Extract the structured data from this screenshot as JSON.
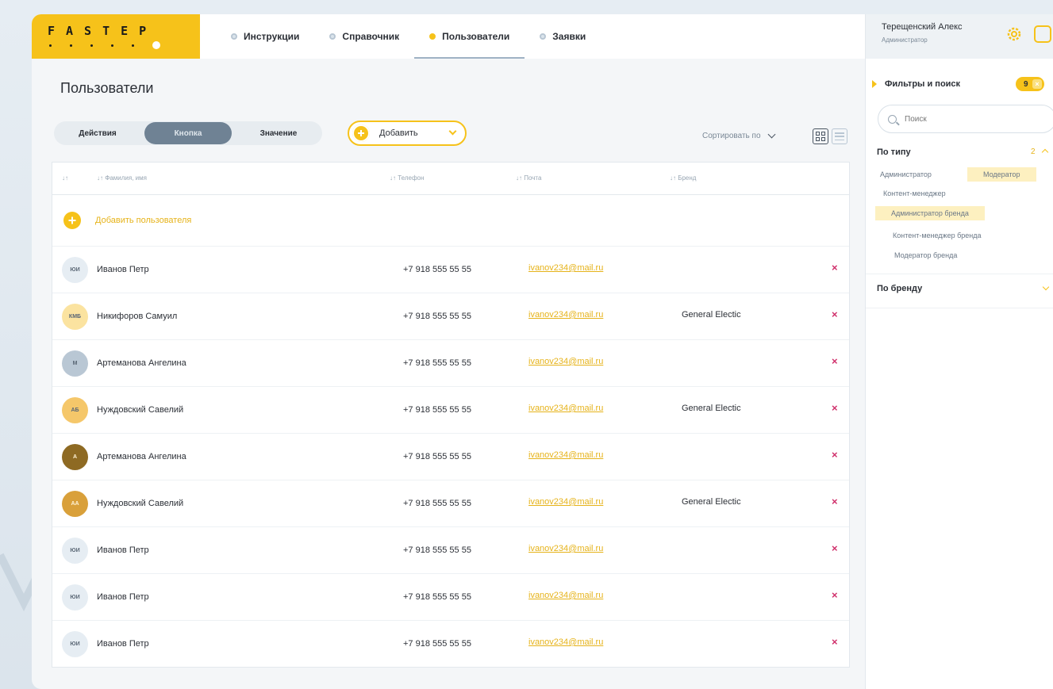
{
  "logo": {
    "text": "FASTEP"
  },
  "nav": [
    {
      "label": "Инструкции",
      "active": false
    },
    {
      "label": "Справочник",
      "active": false
    },
    {
      "label": "Пользователи",
      "active": true
    },
    {
      "label": "Заявки",
      "active": false
    }
  ],
  "page": {
    "title": "Пользователи"
  },
  "segment": {
    "items": [
      "Действия",
      "Кнопка",
      "Значение"
    ],
    "active_index": 1
  },
  "add_button": {
    "label": "Добавить"
  },
  "sort": {
    "label": "Сортировать по"
  },
  "table": {
    "columns": [
      "Фамилия, имя",
      "Телефон",
      "Почта",
      "Бренд"
    ],
    "add_row_label": "Добавить пользователя",
    "rows": [
      {
        "initials": "ЮИ",
        "name": "Иванов Петр",
        "phone": "+7 918 555 55 55",
        "email": "ivanov234@mail.ru",
        "brand": "",
        "avatar_color": "#e6edf3"
      },
      {
        "initials": "КМБ",
        "name": "Никифоров Самуил",
        "phone": "+7 918 555 55 55",
        "email": "ivanov234@mail.ru",
        "brand": "General Electic",
        "avatar_color": "#fbe3a0"
      },
      {
        "initials": "М",
        "name": "Артеманова Ангелина",
        "phone": "+7 918 555 55 55",
        "email": "ivanov234@mail.ru",
        "brand": "",
        "avatar_color": "#b9c7d4"
      },
      {
        "initials": "АБ",
        "name": "Нуждовский Савелий",
        "phone": "+7 918 555 55 55",
        "email": "ivanov234@mail.ru",
        "brand": "General Electic",
        "avatar_color": "#f5c76a"
      },
      {
        "initials": "А",
        "name": "Артеманова Ангелина",
        "phone": "+7 918 555 55 55",
        "email": "ivanov234@mail.ru",
        "brand": "",
        "avatar_color": "#8e6a23"
      },
      {
        "initials": "АА",
        "name": "Нуждовский Савелий",
        "phone": "+7 918 555 55 55",
        "email": "ivanov234@mail.ru",
        "brand": "General Electic",
        "avatar_color": "#d9a03a"
      },
      {
        "initials": "ЮИ",
        "name": "Иванов Петр",
        "phone": "+7 918 555 55 55",
        "email": "ivanov234@mail.ru",
        "brand": "",
        "avatar_color": "#e6edf3"
      },
      {
        "initials": "ЮИ",
        "name": "Иванов Петр",
        "phone": "+7 918 555 55 55",
        "email": "ivanov234@mail.ru",
        "brand": "",
        "avatar_color": "#e6edf3"
      },
      {
        "initials": "ЮИ",
        "name": "Иванов Петр",
        "phone": "+7 918 555 55 55",
        "email": "ivanov234@mail.ru",
        "brand": "",
        "avatar_color": "#e6edf3"
      }
    ],
    "delete_glyph": "×"
  },
  "user": {
    "name": "Терещенский Алекс",
    "role": "Администратор"
  },
  "filters": {
    "title": "Фильтры и поиск",
    "count": "9",
    "search_placeholder": "Поиск",
    "by_type": {
      "title": "По типу",
      "count": "2",
      "tags": [
        {
          "label": "Администратор",
          "selected": false
        },
        {
          "label": "Модератор",
          "selected": true
        },
        {
          "label": "Контент-менеджер",
          "selected": false
        },
        {
          "label": "Администратор бренда",
          "selected": true
        },
        {
          "label": "Контент-менеджер бренда",
          "selected": false
        },
        {
          "label": "Модератор бренда",
          "selected": false
        }
      ]
    },
    "by_brand": {
      "title": "По бренду"
    }
  },
  "colors": {
    "accent": "#f6c21a",
    "delete": "#d0306b",
    "link": "#e6b31a"
  }
}
